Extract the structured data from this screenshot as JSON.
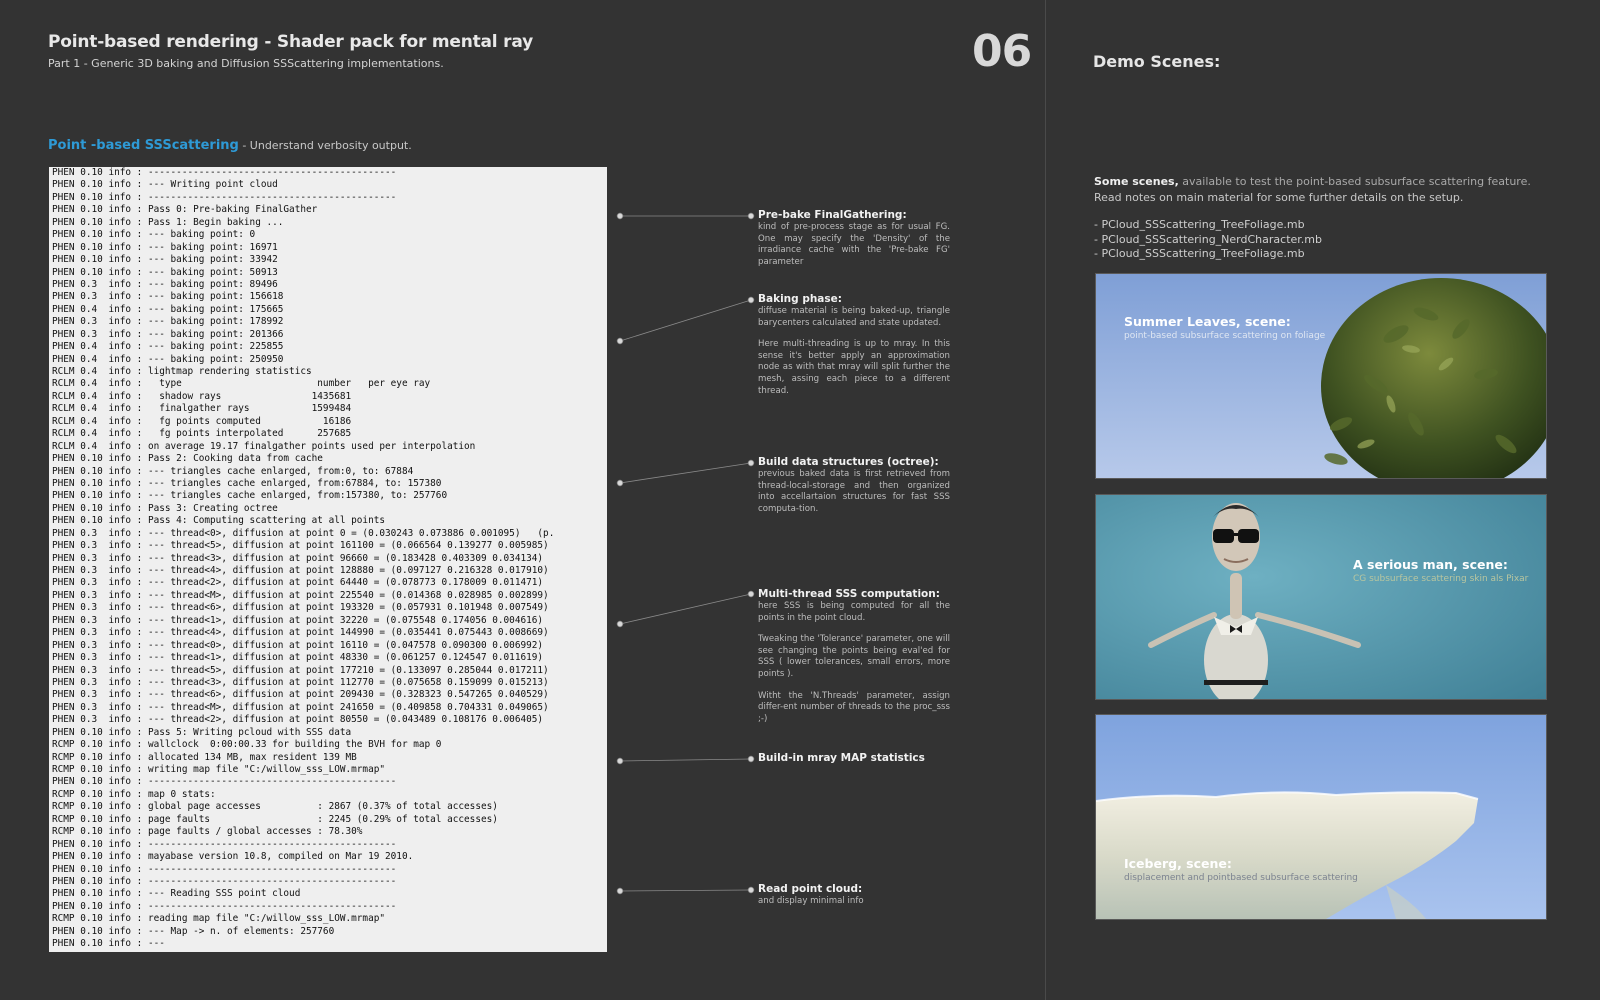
{
  "header": {
    "title": "Point-based  rendering - Shader pack for mental ray",
    "subtitle": "Part 1 - Generic 3D baking and Diffusion SSScattering implementations.",
    "page_number": "06"
  },
  "section": {
    "accent": "Point -based SSScattering",
    "rest": " -  Understand verbosity output."
  },
  "log_lines": [
    "PHEN 0.10 info : --------------------------------------------",
    "PHEN 0.10 info : --- Writing point cloud",
    "PHEN 0.10 info : --------------------------------------------",
    "PHEN 0.10 info : Pass 0: Pre-baking FinalGather",
    "PHEN 0.10 info : Pass 1: Begin baking ...",
    "PHEN 0.10 info : --- baking point: 0",
    "PHEN 0.10 info : --- baking point: 16971",
    "PHEN 0.10 info : --- baking point: 33942",
    "PHEN 0.10 info : --- baking point: 50913",
    "PHEN 0.3  info : --- baking point: 89496",
    "PHEN 0.3  info : --- baking point: 156618",
    "PHEN 0.4  info : --- baking point: 175665",
    "PHEN 0.3  info : --- baking point: 178992",
    "PHEN 0.3  info : --- baking point: 201366",
    "PHEN 0.4  info : --- baking point: 225855",
    "PHEN 0.4  info : --- baking point: 250950",
    "RCLM 0.4  info : lightmap rendering statistics",
    "RCLM 0.4  info :   type                        number   per eye ray",
    "RCLM 0.4  info :   shadow rays                1435681",
    "RCLM 0.4  info :   finalgather rays           1599484",
    "RCLM 0.4  info :   fg points computed           16186",
    "RCLM 0.4  info :   fg points interpolated      257685",
    "RCLM 0.4  info : on average 19.17 finalgather points used per interpolation",
    "PHEN 0.10 info : Pass 2: Cooking data from cache",
    "PHEN 0.10 info : --- triangles cache enlarged, from:0, to: 67884",
    "PHEN 0.10 info : --- triangles cache enlarged, from:67884, to: 157380",
    "PHEN 0.10 info : --- triangles cache enlarged, from:157380, to: 257760",
    "PHEN 0.10 info : Pass 3: Creating octree",
    "PHEN 0.10 info : Pass 4: Computing scattering at all points",
    "PHEN 0.3  info : --- thread<0>, diffusion at point 0 = (0.030243 0.073886 0.001095)   (p.",
    "PHEN 0.3  info : --- thread<5>, diffusion at point 161100 = (0.066564 0.139277 0.005985)",
    "PHEN 0.3  info : --- thread<3>, diffusion at point 96660 = (0.183428 0.403309 0.034134)",
    "PHEN 0.3  info : --- thread<4>, diffusion at point 128880 = (0.097127 0.216328 0.017910)",
    "PHEN 0.3  info : --- thread<2>, diffusion at point 64440 = (0.078773 0.178009 0.011471)",
    "PHEN 0.3  info : --- thread<M>, diffusion at point 225540 = (0.014368 0.028985 0.002899)",
    "PHEN 0.3  info : --- thread<6>, diffusion at point 193320 = (0.057931 0.101948 0.007549)",
    "PHEN 0.3  info : --- thread<1>, diffusion at point 32220 = (0.075548 0.174056 0.004616)",
    "PHEN 0.3  info : --- thread<4>, diffusion at point 144990 = (0.035441 0.075443 0.008669)",
    "PHEN 0.3  info : --- thread<0>, diffusion at point 16110 = (0.047578 0.090300 0.006992)",
    "PHEN 0.3  info : --- thread<1>, diffusion at point 48330 = (0.061257 0.124547 0.011619)",
    "PHEN 0.3  info : --- thread<5>, diffusion at point 177210 = (0.133097 0.285044 0.017211)",
    "PHEN 0.3  info : --- thread<3>, diffusion at point 112770 = (0.075658 0.159099 0.015213)",
    "PHEN 0.3  info : --- thread<6>, diffusion at point 209430 = (0.328323 0.547265 0.040529)",
    "PHEN 0.3  info : --- thread<M>, diffusion at point 241650 = (0.409858 0.704331 0.049065)",
    "PHEN 0.3  info : --- thread<2>, diffusion at point 80550 = (0.043489 0.108176 0.006405)",
    "PHEN 0.10 info : Pass 5: Writing pcloud with SSS data",
    "RCMP 0.10 info : wallclock  0:00:00.33 for building the BVH for map 0",
    "RCMP 0.10 info : allocated 134 MB, max resident 139 MB",
    "RCMP 0.10 info : writing map file \"C:/willow_sss_LOW.mrmap\"",
    "PHEN 0.10 info : --------------------------------------------",
    "RCMP 0.10 info : map 0 stats:",
    "RCMP 0.10 info : global page accesses          : 2867 (0.37% of total accesses)",
    "RCMP 0.10 info : page faults                   : 2245 (0.29% of total accesses)",
    "RCMP 0.10 info : page faults / global accesses : 78.30%",
    "PHEN 0.10 info : --------------------------------------------",
    "PHEN 0.10 info : mayabase version 10.8, compiled on Mar 19 2010.",
    "PHEN 0.10 info : --------------------------------------------",
    "PHEN 0.10 info : --------------------------------------------",
    "PHEN 0.10 info : --- Reading SSS point cloud",
    "PHEN 0.10 info : --------------------------------------------",
    "RCMP 0.10 info : reading map file \"C:/willow_sss_LOW.mrmap\"",
    "PHEN 0.10 info : --- Map -> n. of elements: 257760",
    "PHEN 0.10 info : ---"
  ],
  "notes": [
    {
      "title": "Pre-bake FinalGathering:",
      "paragraphs": [
        "kind of pre-process stage as for usual FG. One may specify the 'Density' of the irradiance cache with the 'Pre-bake FG' parameter"
      ]
    },
    {
      "title": "Baking phase:",
      "paragraphs": [
        "diffuse material is being baked-up, triangle barycenters calculated and state updated.",
        "Here multi-threading is up to mray. In this sense it's better apply an approximation node as with that mray will split further the mesh, assing each piece to a different thread."
      ]
    },
    {
      "title": "Build data structures (octree):",
      "paragraphs": [
        "previous baked data is first retrieved from thread-local-storage and then organized into accellartaion structures for fast SSS computa-tion."
      ]
    },
    {
      "title": "Multi-thread SSS computation:",
      "paragraphs": [
        "here SSS is being computed for all the points in the point cloud.",
        "Tweaking the 'Tolerance' parameter, one will see changing the points being eval'ed for SSS ( lower tolerances, small errors, more points ).",
        "Witht the 'N.Threads' parameter, assign differ-ent number of threads to the proc_sss ;-)"
      ]
    },
    {
      "title": "Build-in mray MAP statistics",
      "paragraphs": []
    },
    {
      "title": "Read point cloud:",
      "paragraphs": [
        "and display minimal info"
      ]
    }
  ],
  "demo": {
    "title": "Demo Scenes:",
    "intro_bold": "Some scenes,",
    "intro_highlight": " available to test the point-based subsurface scattering feature.",
    "intro_line2": "Read notes on main material for some further details on the setup.",
    "files": [
      "- PCloud_SSScattering_TreeFoliage.mb",
      "- PCloud_SSScattering_NerdCharacter.mb",
      "- PCloud_SSScattering_TreeFoliage.mb"
    ],
    "scenes": [
      {
        "title": "Summer Leaves, scene:",
        "subtitle": "point-based subsurface scattering on foliage"
      },
      {
        "title": "A serious man, scene:",
        "subtitle": "CG subsurface scattering skin als Pixar"
      },
      {
        "title": "Iceberg, scene:",
        "subtitle": "displacement and pointbased subsurface  scattering"
      }
    ]
  },
  "colors": {
    "background": "#333333",
    "accent": "#2e9ad6",
    "log_background": "#efefef"
  }
}
